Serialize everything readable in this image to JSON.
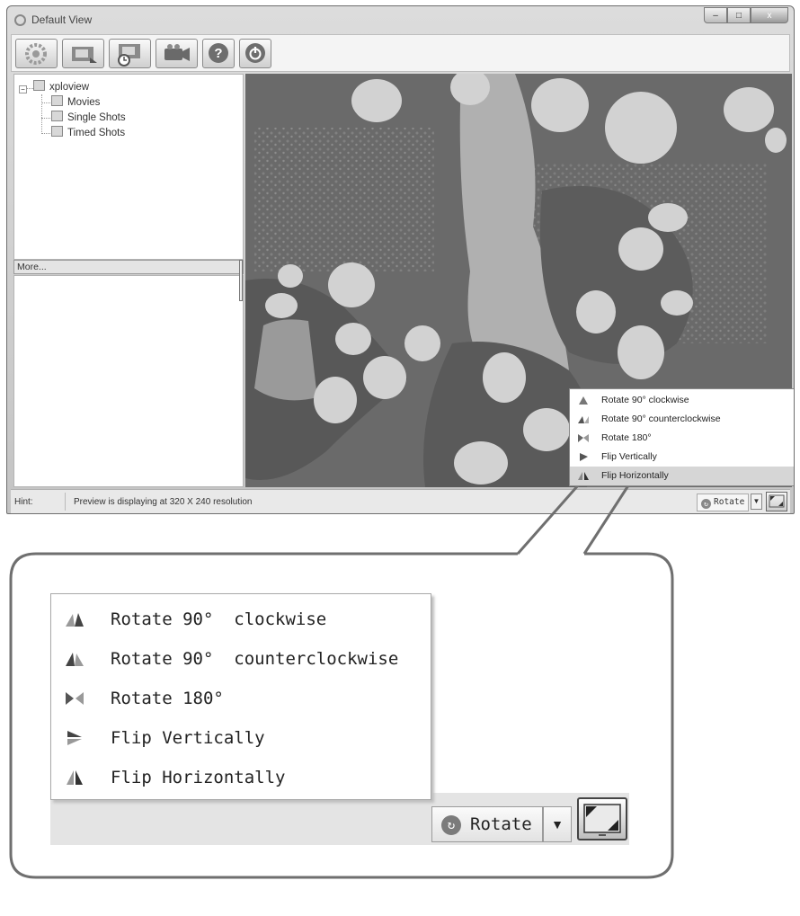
{
  "window": {
    "title": "Default View",
    "controls": {
      "minimize": "–",
      "maximize": "□",
      "close": "x"
    }
  },
  "toolbar": {
    "buttons": [
      {
        "icon": "camera-settings-icon"
      },
      {
        "icon": "snapshot-icon"
      },
      {
        "icon": "timed-capture-icon"
      },
      {
        "icon": "video-camera-icon"
      },
      {
        "icon": "help-icon"
      },
      {
        "icon": "power-icon"
      }
    ]
  },
  "tree": {
    "root": "xploview",
    "expander": "−",
    "children": [
      "Movies",
      "Single Shots",
      "Timed Shots"
    ]
  },
  "more_label": "More...",
  "status": {
    "hint_label": "Hint:",
    "hint_text": "Preview is displaying at 320 X 240 resolution",
    "rotate_label": "Rotate",
    "rotate_icon_glyph": "↻",
    "dropdown_glyph": "▼"
  },
  "rotate_menu_small": {
    "items": [
      "Rotate 90° clockwise",
      "Rotate 90° counterclockwise",
      "Rotate 180°",
      "Flip Vertically",
      "Flip Horizontally"
    ],
    "highlighted_index": 4
  },
  "callout": {
    "menu_items": [
      "Rotate 90°  clockwise",
      "Rotate 90°  counterclockwise",
      "Rotate 180°",
      "Flip Vertically",
      "Flip Horizontally"
    ],
    "rotate_label": "Rotate",
    "rotate_icon_glyph": "↻",
    "dropdown_glyph": "▼"
  },
  "colors": {
    "highlight": "#d6d6d6",
    "callout_border": "#6f6f6f",
    "preview_bg": "#707070",
    "cell": "#d2d2d2"
  }
}
